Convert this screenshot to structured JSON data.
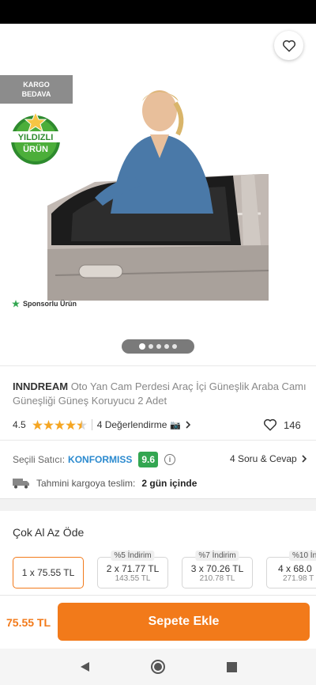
{
  "badges": {
    "kargo_line1": "KARGO",
    "kargo_line2": "BEDAVA",
    "yildizli_line1": "YILDIZLI",
    "yildizli_line2": "ÜRÜN",
    "sponsored": "Sponsorlu Ürün"
  },
  "carousel": {
    "page_count": 5,
    "active_index": 0
  },
  "product": {
    "brand": "INNDREAM",
    "name": "Oto Yan Cam Perdesi Araç İçi Güneşlik Araba Camı Güneşliği Güneş Koruyucu 2 Adet",
    "rating": "4.5",
    "rating_stars": 4.5,
    "reviews": "4 Değerlendirme",
    "favorites": "146"
  },
  "seller": {
    "label": "Seçili Satıcı:",
    "name": "KONFORMISS",
    "score": "9.6",
    "qa": "4 Soru & Cevap"
  },
  "delivery": {
    "label": "Tahmini kargoya teslim:",
    "value": "2 gün içinde"
  },
  "bulk": {
    "title": "Çok Al Az Öde",
    "options": [
      {
        "main": "1 x 75.55 TL",
        "sub": "",
        "tag": ""
      },
      {
        "main": "2 x 71.77 TL",
        "sub": "143.55 TL",
        "tag": "%5 İndirim"
      },
      {
        "main": "3 x 70.26 TL",
        "sub": "210.78 TL",
        "tag": "%7 İndirim"
      },
      {
        "main": "4 x 68.0",
        "sub": "271.98 T",
        "tag": "%10 İn"
      }
    ]
  },
  "cart": {
    "price": "75.55 TL",
    "button": "Sepete Ekle"
  },
  "colors": {
    "accent": "#f27a1a",
    "seller_link": "#2b8acf",
    "score_bg": "#33a651",
    "star": "#f5a623"
  }
}
